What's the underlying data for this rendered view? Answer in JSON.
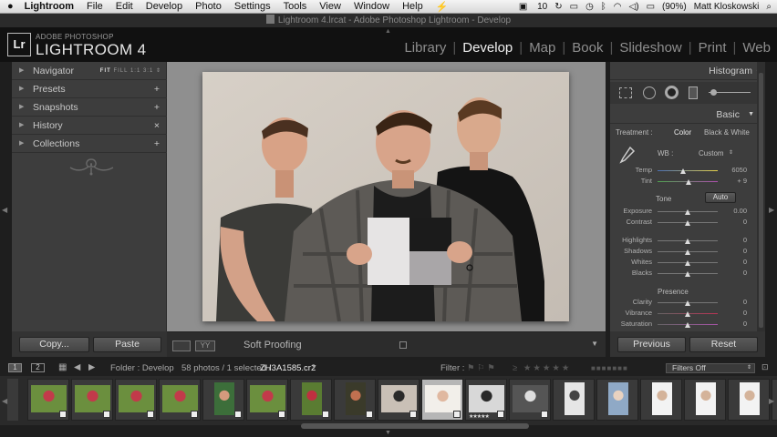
{
  "menubar": {
    "app": "Lightroom",
    "menus": [
      "File",
      "Edit",
      "Develop",
      "Photo",
      "Settings",
      "Tools",
      "View",
      "Window",
      "Help"
    ],
    "status_date": "10",
    "battery": "(90%)",
    "user": "Matt Kloskowski"
  },
  "window_title": "Lightroom 4.lrcat - Adobe Photoshop Lightroom - Develop",
  "identity": {
    "badge": "Lr",
    "subtitle": "ADOBE PHOTOSHOP",
    "name": "LIGHTROOM 4"
  },
  "modules": [
    {
      "label": "Library",
      "active": false
    },
    {
      "label": "Develop",
      "active": true
    },
    {
      "label": "Map",
      "active": false
    },
    {
      "label": "Book",
      "active": false
    },
    {
      "label": "Slideshow",
      "active": false
    },
    {
      "label": "Print",
      "active": false
    },
    {
      "label": "Web",
      "active": false
    }
  ],
  "left_panel": {
    "navigator": {
      "label": "Navigator",
      "options": [
        "FIT",
        "FILL",
        "1:1",
        "3:1"
      ]
    },
    "items": [
      {
        "label": "Presets",
        "action": "+"
      },
      {
        "label": "Snapshots",
        "action": "+"
      },
      {
        "label": "History",
        "action": "×"
      },
      {
        "label": "Collections",
        "action": "+"
      }
    ],
    "copy_label": "Copy...",
    "paste_label": "Paste"
  },
  "toolbar": {
    "soft_proofing_label": "Soft Proofing",
    "view_yy": "YY"
  },
  "right_panel": {
    "histogram_label": "Histogram",
    "basic_label": "Basic",
    "treatment_label": "Treatment :",
    "treatment_color": "Color",
    "treatment_bw": "Black & White",
    "wb_label": "WB :",
    "wb_value": "Custom",
    "tone_label": "Tone",
    "auto_label": "Auto",
    "presence_label": "Presence",
    "sliders_wb": [
      {
        "label": "Temp",
        "value": "6050",
        "position": 0.42
      },
      {
        "label": "Tint",
        "value": "+ 9",
        "position": 0.52
      }
    ],
    "sliders_tone1": [
      {
        "label": "Exposure",
        "value": "0.00",
        "position": 0.5
      },
      {
        "label": "Contrast",
        "value": "0",
        "position": 0.5
      }
    ],
    "sliders_tone2": [
      {
        "label": "Highlights",
        "value": "0",
        "position": 0.5
      },
      {
        "label": "Shadows",
        "value": "0",
        "position": 0.5
      },
      {
        "label": "Whites",
        "value": "0",
        "position": 0.5
      },
      {
        "label": "Blacks",
        "value": "0",
        "position": 0.5
      }
    ],
    "sliders_presence": [
      {
        "label": "Clarity",
        "value": "0",
        "position": 0.5
      },
      {
        "label": "Vibrance",
        "value": "0",
        "position": 0.5
      },
      {
        "label": "Saturation",
        "value": "0",
        "position": 0.5
      }
    ],
    "previous_label": "Previous",
    "reset_label": "Reset"
  },
  "filmstrip_bar": {
    "page1": "1",
    "page2": "2",
    "folder": "Folder : Develop",
    "count": "58 photos / 1 selected /",
    "filename": "ZH3A1585.cr2",
    "filter_label": "Filter :",
    "filters_off": "Filters Off"
  },
  "filmstrip": {
    "selected_index": 9,
    "stars": "★★★★★",
    "thumbs": [
      "group-green",
      "group-green",
      "group-green",
      "group-green",
      "portrait-girl",
      "group-green",
      "portrait-red",
      "portrait-dark",
      "three-men",
      "baby",
      "architecture",
      "mono-building",
      "tower",
      "woman-blue",
      "bride",
      "bride",
      "bride",
      "bride"
    ]
  },
  "colors": {
    "accent_active": "#f0f0f0",
    "panel_bg": "#3d3d3d"
  }
}
